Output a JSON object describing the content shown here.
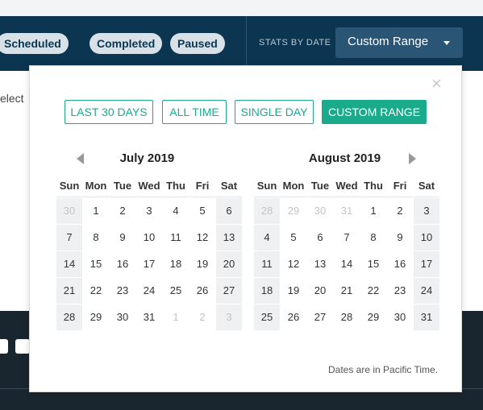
{
  "nav": {
    "filters": [
      {
        "label": "Scheduled"
      },
      {
        "label": "Completed"
      },
      {
        "label": "Paused"
      }
    ],
    "stats_label": "STATS BY DATE",
    "range_value": "Custom Range"
  },
  "background_text": "elect",
  "popover": {
    "close_label": "×",
    "presets": [
      "LAST 30 DAYS",
      "ALL TIME",
      "SINGLE DAY",
      "CUSTOM RANGE"
    ],
    "weekdays": [
      "Sun",
      "Mon",
      "Tue",
      "Wed",
      "Thu",
      "Fri",
      "Sat"
    ],
    "months": [
      {
        "title": "July 2019",
        "days": [
          {
            "d": "30",
            "muted": true
          },
          {
            "d": "1"
          },
          {
            "d": "2"
          },
          {
            "d": "3"
          },
          {
            "d": "4"
          },
          {
            "d": "5"
          },
          {
            "d": "6"
          },
          {
            "d": "7"
          },
          {
            "d": "8"
          },
          {
            "d": "9"
          },
          {
            "d": "10"
          },
          {
            "d": "11"
          },
          {
            "d": "12"
          },
          {
            "d": "13"
          },
          {
            "d": "14"
          },
          {
            "d": "15"
          },
          {
            "d": "16"
          },
          {
            "d": "17"
          },
          {
            "d": "18"
          },
          {
            "d": "19"
          },
          {
            "d": "20"
          },
          {
            "d": "21"
          },
          {
            "d": "22"
          },
          {
            "d": "23"
          },
          {
            "d": "24"
          },
          {
            "d": "25"
          },
          {
            "d": "26"
          },
          {
            "d": "27"
          },
          {
            "d": "28"
          },
          {
            "d": "29"
          },
          {
            "d": "30"
          },
          {
            "d": "31"
          },
          {
            "d": "1",
            "muted": true
          },
          {
            "d": "2",
            "muted": true
          },
          {
            "d": "3",
            "muted": true
          }
        ]
      },
      {
        "title": "August 2019",
        "days": [
          {
            "d": "28",
            "muted": true
          },
          {
            "d": "29",
            "muted": true
          },
          {
            "d": "30",
            "muted": true
          },
          {
            "d": "31",
            "muted": true
          },
          {
            "d": "1"
          },
          {
            "d": "2"
          },
          {
            "d": "3"
          },
          {
            "d": "4"
          },
          {
            "d": "5"
          },
          {
            "d": "6"
          },
          {
            "d": "7"
          },
          {
            "d": "8"
          },
          {
            "d": "9"
          },
          {
            "d": "10"
          },
          {
            "d": "11"
          },
          {
            "d": "12"
          },
          {
            "d": "13"
          },
          {
            "d": "14"
          },
          {
            "d": "15"
          },
          {
            "d": "16"
          },
          {
            "d": "17"
          },
          {
            "d": "18"
          },
          {
            "d": "19"
          },
          {
            "d": "20"
          },
          {
            "d": "21"
          },
          {
            "d": "22"
          },
          {
            "d": "23"
          },
          {
            "d": "24"
          },
          {
            "d": "25"
          },
          {
            "d": "26"
          },
          {
            "d": "27"
          },
          {
            "d": "28"
          },
          {
            "d": "29"
          },
          {
            "d": "30"
          },
          {
            "d": "31"
          }
        ]
      }
    ],
    "timezone_note": "Dates are in Pacific Time."
  },
  "footer": {
    "icons": [
      "facebook-icon",
      "twitter-icon"
    ]
  },
  "colors": {
    "navbar": "#0b3550",
    "accent": "#1aab8b",
    "footer": "#1a262f"
  }
}
